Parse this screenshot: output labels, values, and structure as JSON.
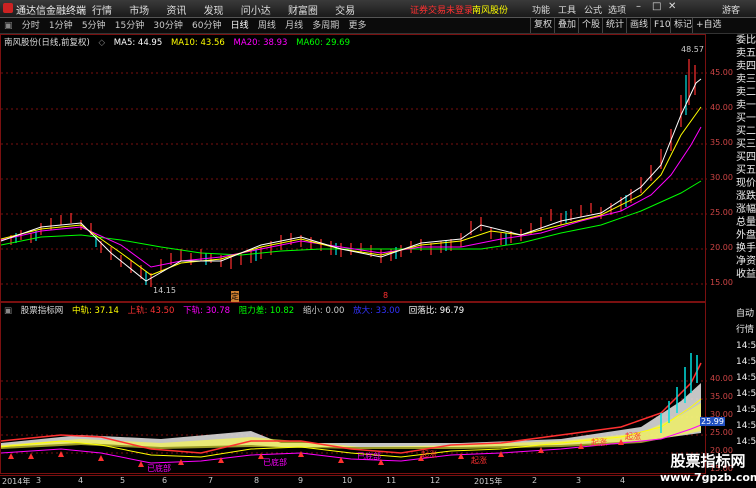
{
  "app": {
    "title": "通达信金融终端",
    "menu": [
      "行情",
      "市场",
      "资讯",
      "发现",
      "问小达",
      "财富圈",
      "交易"
    ],
    "notice": "证券交易未登录",
    "stock_name_header": "南风股份",
    "right_menu": [
      "功能",
      "工具",
      "公式",
      "选项"
    ],
    "user": "游客"
  },
  "timeframes": {
    "items": [
      "分时",
      "1分钟",
      "5分钟",
      "15分钟",
      "30分钟",
      "60分钟",
      "日线",
      "周线",
      "月线",
      "多周期",
      "更多"
    ],
    "active": "日线"
  },
  "toolbar_right": [
    "复权",
    "叠加",
    "个股",
    "统计",
    "画线",
    "F10",
    "标记",
    "+自选"
  ],
  "price_panel": {
    "stock_label": "南风股份(日线,前复权)",
    "ma": [
      {
        "label": "MA5: 44.95",
        "color": "#ffffff"
      },
      {
        "label": "MA10: 43.56",
        "color": "#ffff00"
      },
      {
        "label": "MA20: 38.93",
        "color": "#ff00ff"
      },
      {
        "label": "MA60: 29.69",
        "color": "#00ff00"
      }
    ],
    "high_label": "48.57",
    "low_label": "14.15",
    "axis": [
      "45.00",
      "40.00",
      "35.00",
      "30.00",
      "25.00",
      "20.00",
      "15.00"
    ],
    "marks": [
      "定",
      "8"
    ]
  },
  "ind_panel": {
    "name": "股票指标网",
    "values": [
      {
        "label": "中轨: 37.14",
        "color": "#ffff00"
      },
      {
        "label": "上轨: 43.50",
        "color": "#ff3333"
      },
      {
        "label": "下轨: 30.78",
        "color": "#ff00ff"
      },
      {
        "label": "阻力差: 10.82",
        "color": "#00ff00"
      },
      {
        "label": "缩小: 0.00",
        "color": "#cccccc"
      },
      {
        "label": "放大: 33.00",
        "color": "#3333ff"
      },
      {
        "label": "回落比: 96.79",
        "color": "#ffffff"
      }
    ],
    "axis": [
      "40.00",
      "35.00",
      "30.00",
      "25.00",
      "20.00",
      "15.00"
    ],
    "current": "25.99",
    "tags": [
      "已底部",
      "已底部",
      "已底部",
      "起涨",
      "起涨",
      "起涨",
      "起涨"
    ]
  },
  "right_column": [
    "委比",
    "卖五",
    "卖四",
    "卖三",
    "卖二",
    "卖一",
    "买一",
    "买二",
    "买三",
    "买四",
    "买五",
    "现价",
    "涨跌",
    "涨幅",
    "总量",
    "外盘",
    "换手",
    "净资",
    "收益"
  ],
  "right_column2": [
    "自动",
    "行情",
    "14:50",
    "14:50",
    "14:50",
    "14:50",
    "14:50",
    "14:50",
    "14:50",
    "14:50",
    "14:50"
  ],
  "timeline": [
    "2014年",
    "3",
    "4",
    "5",
    "6",
    "7",
    "8",
    "9",
    "10",
    "11",
    "12",
    "2015年",
    "2",
    "3",
    "4"
  ],
  "watermark": {
    "title": "股票指标网",
    "url": "www.7gpzb.com"
  }
}
